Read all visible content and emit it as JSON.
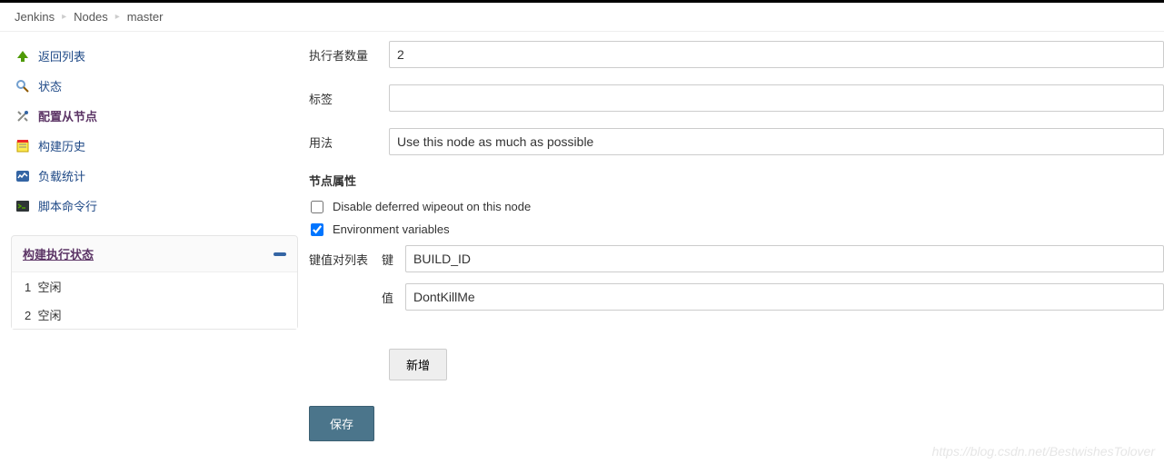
{
  "breadcrumb": {
    "items": [
      "Jenkins",
      "Nodes",
      "master"
    ]
  },
  "sidebar": {
    "items": [
      {
        "label": "返回列表"
      },
      {
        "label": "状态"
      },
      {
        "label": "配置从节点"
      },
      {
        "label": "构建历史"
      },
      {
        "label": "负载统计"
      },
      {
        "label": "脚本命令行"
      }
    ]
  },
  "executors": {
    "title": "构建执行状态",
    "rows": [
      {
        "num": "1",
        "status": "空闲"
      },
      {
        "num": "2",
        "status": "空闲"
      }
    ]
  },
  "form": {
    "executor_count_label": "执行者数量",
    "executor_count_value": "2",
    "labels_label": "标签",
    "labels_value": "",
    "usage_label": "用法",
    "usage_value": "Use this node as much as possible",
    "node_props_title": "节点属性",
    "disable_wipeout_label": "Disable deferred wipeout on this node",
    "env_vars_label": "Environment variables",
    "kv_list_label": "键值对列表",
    "key_label": "键",
    "key_value": "BUILD_ID",
    "value_label": "值",
    "value_value": "DontKillMe",
    "add_button": "新增",
    "save_button": "保存"
  },
  "watermark": "https://blog.csdn.net/BestwishesTolover"
}
